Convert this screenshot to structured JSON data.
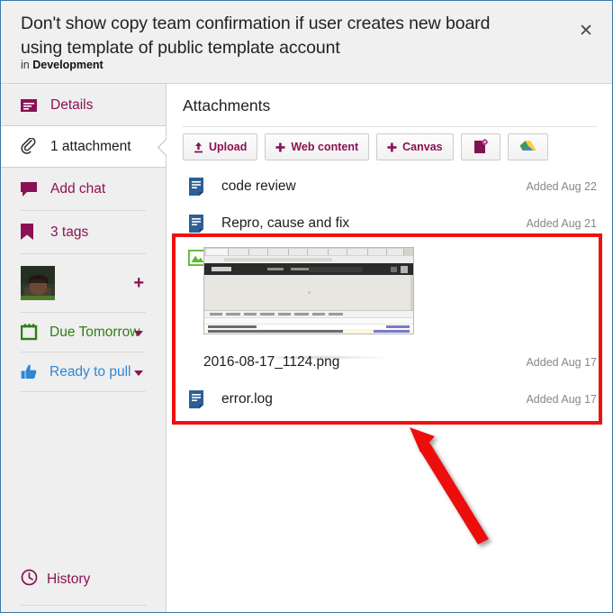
{
  "window": {
    "title": "Don't show copy team confirmation if user creates new board using template of public template account",
    "subtitle_prefix": "in",
    "board_name": "Development",
    "close_icon": "close-icon",
    "close_glyph": "✕",
    "border_color": "#3c78a8"
  },
  "sidebar": {
    "items": [
      {
        "label": "Details",
        "icon": "details-icon",
        "active": false
      },
      {
        "label": "1 attachment",
        "icon": "paperclip-icon",
        "active": true
      },
      {
        "label": "Add chat",
        "icon": "chat-bubble-icon",
        "active": false
      },
      {
        "label": "3 tags",
        "icon": "tag-bookmark-icon",
        "active": false
      }
    ],
    "member": {
      "avatar_name": "avatar",
      "add_member_icon": "plus-icon",
      "add_member_glyph": "+"
    },
    "meta": [
      {
        "label": "Due Tomorrow",
        "icon": "calendar-icon",
        "color": "#2f7d16",
        "caret": "chevron-down-icon"
      },
      {
        "label": "Ready to pull",
        "icon": "thumbs-up-icon",
        "color": "#2d87d4",
        "caret": "chevron-down-icon"
      }
    ],
    "history": {
      "label": "History",
      "icon": "clock-icon"
    },
    "accent_color": "#8a1253"
  },
  "main": {
    "heading": "Attachments",
    "toolbar": [
      {
        "label": "Upload",
        "icon": "upload-arrow-icon",
        "glyph": "↑"
      },
      {
        "label": "Web content",
        "icon": "plus-icon",
        "glyph": "+"
      },
      {
        "label": "Canvas",
        "icon": "plus-icon",
        "glyph": "+"
      },
      {
        "label": "",
        "icon": "document-gear-icon",
        "glyph": ""
      },
      {
        "label": "",
        "icon": "google-drive-icon",
        "glyph": ""
      }
    ],
    "attachments": [
      {
        "name": "code review",
        "added": "Added Aug 22",
        "icon": "document-icon",
        "type": "file"
      },
      {
        "name": "Repro, cause and fix",
        "added": "Added Aug 21",
        "icon": "document-icon",
        "type": "file"
      },
      {
        "name": "2016-08-17_1124.png",
        "added": "Added Aug 17",
        "icon": "image-icon",
        "type": "image"
      },
      {
        "name": "error.log",
        "added": "Added Aug 17",
        "icon": "document-icon",
        "type": "file"
      }
    ]
  },
  "annotations": {
    "highlight_color": "#ee1111",
    "arrow_name": "red-pointer-arrow",
    "box_name": "red-highlight-box"
  }
}
